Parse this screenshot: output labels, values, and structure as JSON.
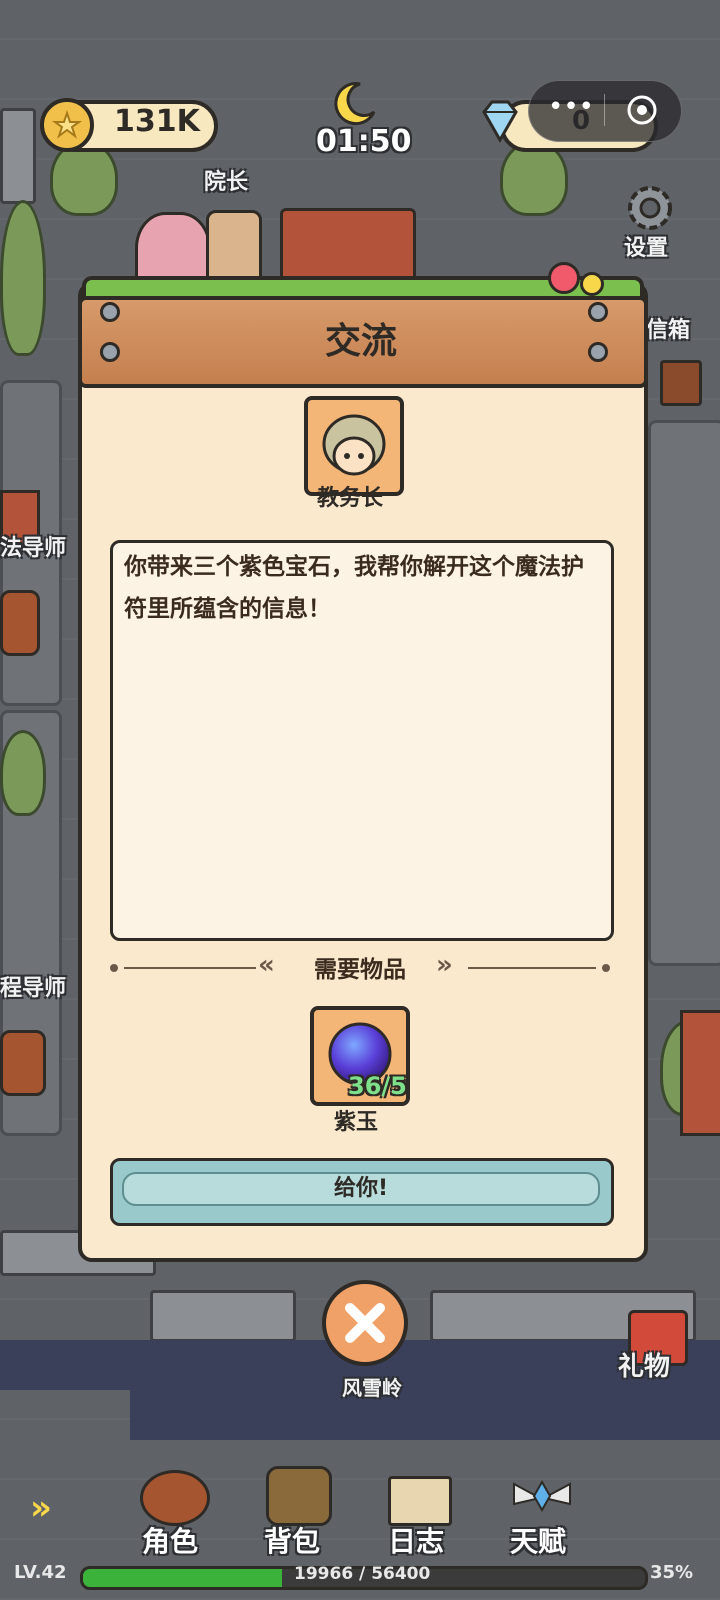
{
  "hud": {
    "coins": "131K",
    "time": "01:50",
    "gems": "0"
  },
  "map_labels": {
    "dean": "院长",
    "settings": "设置",
    "mailbox": "信箱",
    "mentor_left": "法导师",
    "mentor_left2": "程导师",
    "gift": "礼物",
    "area": "风雪岭"
  },
  "dialog": {
    "title": "交流",
    "npc_name": "教务长",
    "message": "你带来三个紫色宝石，我帮你解开这个魔法护符里所蕴含的信息！",
    "required_header": "需要物品",
    "item_name": "紫玉",
    "item_count": "36/5",
    "give_button": "给你!"
  },
  "bottom_nav": {
    "character": "角色",
    "backpack": "背包",
    "journal": "日志",
    "talent": "天赋"
  },
  "player": {
    "level": "LV.42",
    "xp_text": "19966 / 56400",
    "xp_percent_label": "35%",
    "xp_progress": 0.354
  },
  "colors": {
    "dialog_bg": "#fae9cd",
    "plank": "#c57f4f",
    "xp_fill": "#3bb33b",
    "button_teal": "#9ac9cc",
    "item_count_green": "#7ee08a"
  }
}
